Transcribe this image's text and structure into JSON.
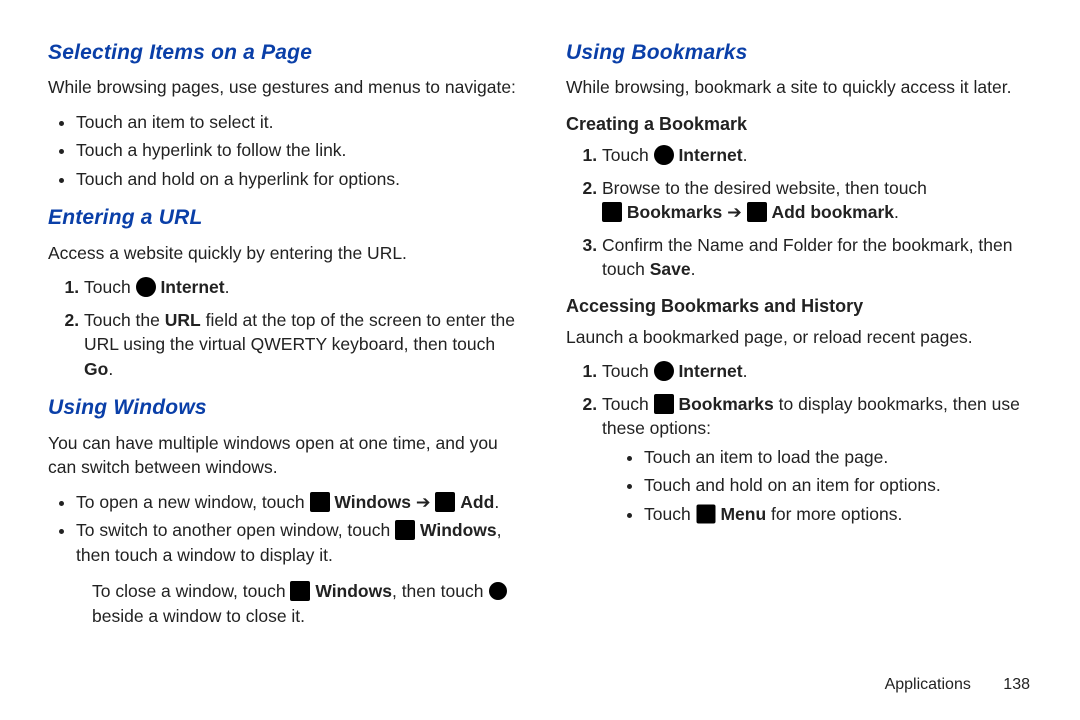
{
  "left": {
    "selecting": {
      "heading": "Selecting Items on a Page",
      "intro": "While browsing pages, use gestures and menus to navigate:",
      "bullets": [
        "Touch an item to select it.",
        "Touch a hyperlink to follow the link.",
        "Touch and hold on a hyperlink for options."
      ]
    },
    "entering": {
      "heading": "Entering a URL",
      "intro": "Access a website quickly by entering the URL.",
      "step1_pre": "Touch ",
      "step1_bold1": "Internet",
      "step1_post": ".",
      "step2_pre": "Touch the ",
      "step2_bold1": "URL",
      "step2_mid": " field at the top of the screen to enter the URL using the virtual QWERTY keyboard, then touch ",
      "step2_bold2": "Go",
      "step2_post": "."
    },
    "windows": {
      "heading": "Using Windows",
      "intro": "You can have multiple windows open at one time, and you can switch between windows.",
      "b1_pre": "To open a new window, touch ",
      "b1_bold1": "Windows",
      "b1_arrow": " ➔ ",
      "b1_bold2": "Add",
      "b1_post": ".",
      "b2_pre": "To switch to another open window, touch ",
      "b2_bold1": "Windows",
      "b2_post": ", then touch a window to display it.",
      "sub_pre": "To close a window, touch ",
      "sub_bold1": "Windows",
      "sub_mid": ", then touch ",
      "sub_post": " beside a window to close it."
    }
  },
  "right": {
    "bookmarks": {
      "heading": "Using Bookmarks",
      "intro": "While browsing, bookmark a site to quickly access it later.",
      "creating": {
        "heading": "Creating a Bookmark",
        "step1_pre": "Touch ",
        "step1_bold1": "Internet",
        "step1_post": ".",
        "step2_pre": "Browse to the desired website, then touch ",
        "step2_bold1": "Bookmarks",
        "step2_arrow": " ➔ ",
        "step2_bold2": "Add bookmark",
        "step2_post": ".",
        "step3_pre": "Confirm the Name and Folder for the bookmark, then touch ",
        "step3_bold1": "Save",
        "step3_post": "."
      },
      "accessing": {
        "heading": "Accessing Bookmarks and History",
        "intro": "Launch a bookmarked page, or reload recent pages.",
        "step1_pre": "Touch ",
        "step1_bold1": "Internet",
        "step1_post": ".",
        "step2_pre": "Touch ",
        "step2_bold1": "Bookmarks",
        "step2_post": " to display bookmarks, then use these options:",
        "bullets_b1": "Touch an item to load the page.",
        "bullets_b2": "Touch and hold on an item for options.",
        "bullets_b3_pre": "Touch ",
        "bullets_b3_bold": "Menu",
        "bullets_b3_post": " for more options."
      }
    }
  },
  "footer": {
    "section": "Applications",
    "page": "138"
  }
}
